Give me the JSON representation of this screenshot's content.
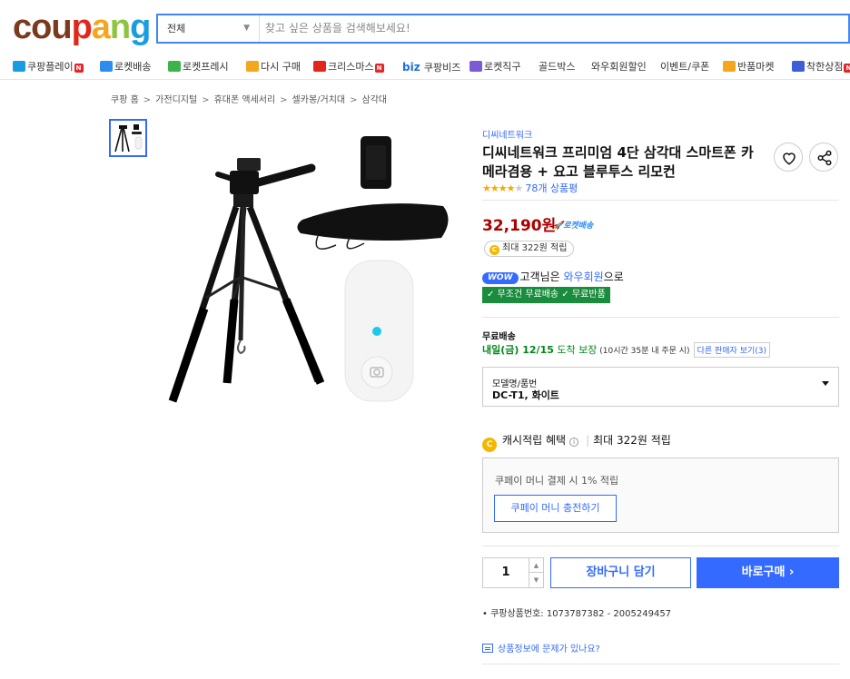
{
  "header": {
    "logo": [
      "cou",
      "p",
      "a",
      "n",
      "g"
    ],
    "search": {
      "category": "전체",
      "placeholder": "찾고 싶은 상품을 검색해보세요!"
    }
  },
  "nav": [
    {
      "label": "쿠팡플레이",
      "icon": "play-icon",
      "badge": "N",
      "color": "#1a9de0"
    },
    {
      "label": "로켓배송",
      "icon": "rocket-icon",
      "badge": "",
      "color": "#2d8cf0"
    },
    {
      "label": "로켓프레시",
      "icon": "rocket-fresh-icon",
      "badge": "",
      "color": "#3cb44b"
    },
    {
      "label": "다시 구매",
      "icon": "reorder-icon",
      "badge": "",
      "color": "#f4a71d"
    },
    {
      "label": "크리스마스",
      "icon": "santa-icon",
      "badge": "N",
      "color": "#e1271b"
    },
    {
      "label": "쿠팡비즈",
      "icon": "biz-icon",
      "badge": "",
      "color": "#1a6fe0",
      "prefix": "biz"
    },
    {
      "label": "로켓직구",
      "icon": "globe-icon",
      "badge": "",
      "color": "#7b5cd6"
    },
    {
      "label": "골드박스",
      "icon": "",
      "badge": "",
      "color": ""
    },
    {
      "label": "와우회원할인",
      "icon": "",
      "badge": "",
      "color": ""
    },
    {
      "label": "이벤트/쿠폰",
      "icon": "",
      "badge": "",
      "color": ""
    },
    {
      "label": "반품마켓",
      "icon": "return-market-icon",
      "badge": "",
      "color": "#f4a71d"
    },
    {
      "label": "착한상점",
      "icon": "good-store-icon",
      "badge": "N",
      "color": "#3c5fd6"
    }
  ],
  "breadcrumb": [
    "쿠팡 홈",
    "가전디지털",
    "휴대폰 액세서리",
    "셀카봉/거치대",
    "삼각대"
  ],
  "product": {
    "seller": "디씨네트워크",
    "title": "디씨네트워크 프리미엄 4단 삼각대 스마트폰 카메라겸용 + 요고 블루투스 리모컨",
    "rating": 4,
    "review_count": "78개 상품평",
    "price": "32,190원",
    "rocket": "로켓배송",
    "points": "최대 322원 적립",
    "wow": {
      "badge": "WOW",
      "prefix": "고객님은 ",
      "link": "와우회원",
      "suffix": "으로"
    },
    "free_bar": "✓ 무조건 무료배송 ✓ 무료반품",
    "shipping": {
      "title": "무료배송",
      "date": "내일(금) 12/15",
      "arrive": " 도착 보장",
      "note": " (10시간 35분 내 주문 시)",
      "other_sellers": "다른 판매자 보기(3)"
    },
    "option": {
      "label": "모델명/품번",
      "value": "DC-T1, 화이트"
    },
    "cash": {
      "label": "캐시적립 혜택",
      "value": "최대 322원 적립"
    },
    "coupay": {
      "text": "쿠페이 머니 결제 시 1% 적립",
      "button": "쿠페이 머니 충전하기"
    },
    "quantity": "1",
    "cart_button": "장바구니 담기",
    "buy_button": "바로구매 ›",
    "product_no": "쿠팡상품번호: 1073787382 - 2005249457",
    "report": "상품정보에 문제가 있나요?"
  }
}
